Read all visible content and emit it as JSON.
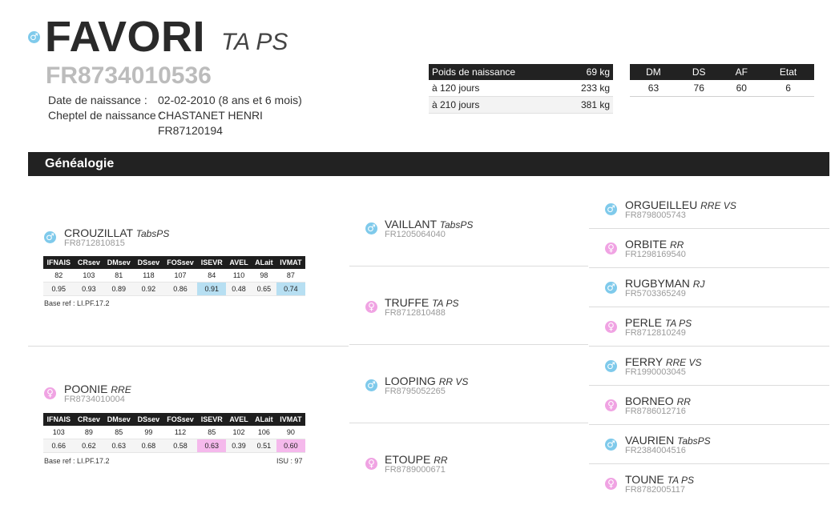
{
  "header": {
    "sex_icon": "♂",
    "name": "FAVORI",
    "qualif": "TA PS",
    "regnum": "FR8734010536",
    "birth_label": "Date de naissance :",
    "birth_value": "02-02-2010 (8 ans et 6 mois)",
    "cheptel_label": "Cheptel de naissance :",
    "cheptel_name": "CHASTANET HENRI",
    "cheptel_num": "FR87120194"
  },
  "weights": {
    "header": {
      "label": "Poids de naissance",
      "value": "69 kg"
    },
    "rows": [
      {
        "label": "à 120 jours",
        "value": "233 kg"
      },
      {
        "label": "à 210 jours",
        "value": "381 kg"
      }
    ]
  },
  "notes": {
    "headers": [
      "DM",
      "DS",
      "AF",
      "Etat"
    ],
    "values": [
      "63",
      "76",
      "60",
      "6"
    ]
  },
  "section_title": "Généalogie",
  "index_headers": [
    "IFNAIS",
    "CRsev",
    "DMsev",
    "DSsev",
    "FOSsev",
    "ISEVR",
    "AVEL",
    "ALait",
    "IVMAT"
  ],
  "sire": {
    "name": "CROUZILLAT",
    "qualif": "TabsPS",
    "id": "FR8712810815",
    "row1": [
      "82",
      "103",
      "81",
      "118",
      "107",
      "84",
      "110",
      "98",
      "87"
    ],
    "row2": [
      "0.95",
      "0.93",
      "0.89",
      "0.92",
      "0.86",
      "0.91",
      "0.48",
      "0.65",
      "0.74"
    ],
    "base_ref": "Base ref : LI.PF.17.2",
    "isu": ""
  },
  "dam": {
    "name": "POONIE",
    "qualif": "RRE",
    "id": "FR8734010004",
    "row1": [
      "103",
      "89",
      "85",
      "99",
      "112",
      "85",
      "102",
      "106",
      "90"
    ],
    "row2": [
      "0.66",
      "0.62",
      "0.63",
      "0.68",
      "0.58",
      "0.63",
      "0.39",
      "0.51",
      "0.60"
    ],
    "base_ref": "Base ref : LI.PF.17.2",
    "isu": "ISU : 97"
  },
  "grandparents": [
    {
      "name": "VAILLANT",
      "qualif": "TabsPS",
      "id": "FR1205064040",
      "sex": "male"
    },
    {
      "name": "TRUFFE",
      "qualif": "TA PS",
      "id": "FR8712810488",
      "sex": "female"
    },
    {
      "name": "LOOPING",
      "qualif": "RR VS",
      "id": "FR8795052265",
      "sex": "male"
    },
    {
      "name": "ETOUPE",
      "qualif": "RR",
      "id": "FR8789000671",
      "sex": "female"
    }
  ],
  "great_grandparents": [
    {
      "name": "ORGUEILLEU",
      "qualif": "RRE VS",
      "id": "FR8798005743",
      "sex": "male"
    },
    {
      "name": "ORBITE",
      "qualif": "RR",
      "id": "FR1298169540",
      "sex": "female"
    },
    {
      "name": "RUGBYMAN",
      "qualif": "RJ",
      "id": "FR5703365249",
      "sex": "male"
    },
    {
      "name": "PERLE",
      "qualif": "TA PS",
      "id": "FR8712810249",
      "sex": "female"
    },
    {
      "name": "FERRY",
      "qualif": "RRE VS",
      "id": "FR1990003045",
      "sex": "male"
    },
    {
      "name": "BORNEO",
      "qualif": "RR",
      "id": "FR8786012716",
      "sex": "female"
    },
    {
      "name": "VAURIEN",
      "qualif": "TabsPS",
      "id": "FR2384004516",
      "sex": "male"
    },
    {
      "name": "TOUNE",
      "qualif": "TA PS",
      "id": "FR8782005117",
      "sex": "female"
    }
  ],
  "icons": {
    "male": "♂",
    "female": "♀",
    "male_color": "#7fcaeb",
    "female_color": "#f0a3e3"
  }
}
